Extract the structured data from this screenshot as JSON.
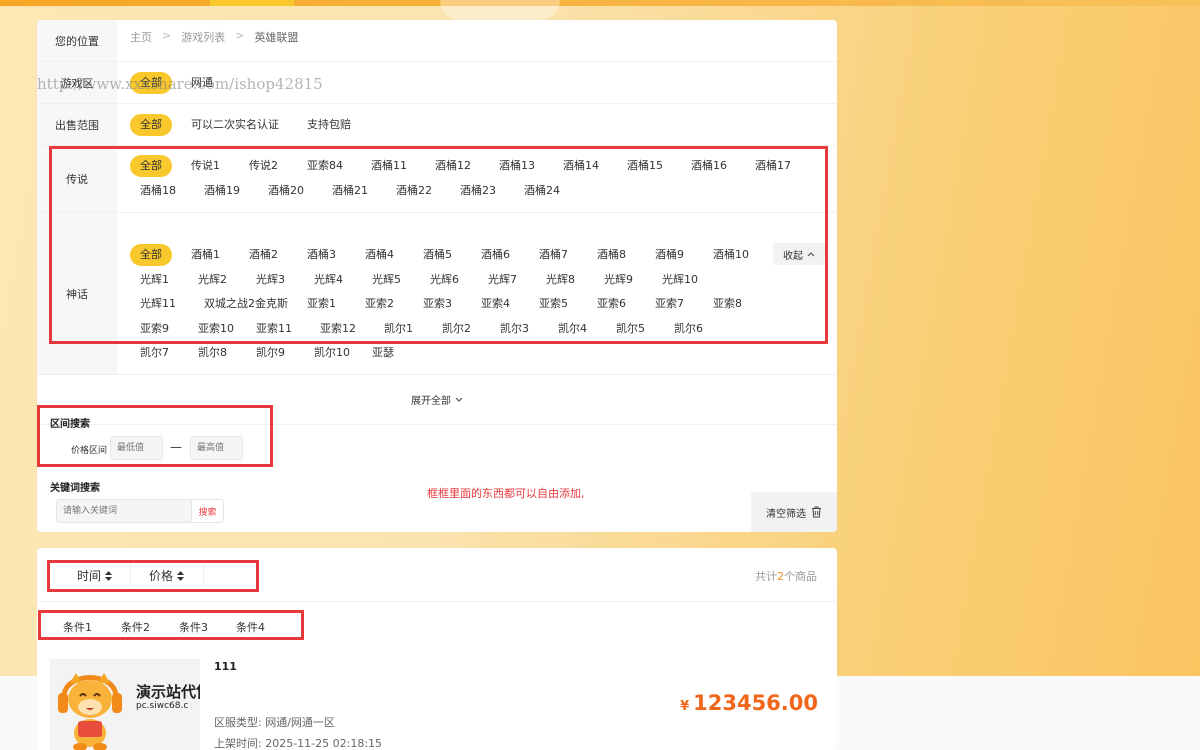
{
  "breadcrumb": {
    "label": "您的位置",
    "items": [
      "主页",
      "游戏列表",
      "英雄联盟"
    ],
    "sep": ">"
  },
  "watermark": "http://www.xxxshare.com/ishop42815",
  "filters": {
    "zone": {
      "label": "游戏区",
      "options": [
        "全部",
        "网通"
      ]
    },
    "scope": {
      "label": "出售范围",
      "options": [
        "全部",
        "可以二次实名认证",
        "支持包赔"
      ]
    },
    "legend": {
      "label": "传说",
      "options": [
        "全部",
        "传说1",
        "传说2",
        "亚索84",
        "酒桶11",
        "酒桶12",
        "酒桶13",
        "酒桶14",
        "酒桶15",
        "酒桶16",
        "酒桶17",
        "酒桶18",
        "酒桶19",
        "酒桶20",
        "酒桶21",
        "酒桶22",
        "酒桶23",
        "酒桶24"
      ]
    },
    "myth": {
      "label": "神话",
      "collapse_label": "收起",
      "options": [
        "全部",
        "酒桶1",
        "酒桶2",
        "酒桶3",
        "酒桶4",
        "酒桶5",
        "酒桶6",
        "酒桶7",
        "酒桶8",
        "酒桶9",
        "酒桶10",
        "光辉1",
        "光辉2",
        "光辉3",
        "光辉4",
        "光辉5",
        "光辉6",
        "光辉7",
        "光辉8",
        "光辉9",
        "光辉10",
        "光辉11",
        "双城之战2金克斯",
        "亚索1",
        "亚索2",
        "亚索3",
        "亚索4",
        "亚索5",
        "亚索6",
        "亚索7",
        "亚索8",
        "亚索9",
        "亚索10",
        "亚索11",
        "亚索12",
        "凯尔1",
        "凯尔2",
        "凯尔3",
        "凯尔4",
        "凯尔5",
        "凯尔6",
        "凯尔7",
        "凯尔8",
        "凯尔9",
        "凯尔10",
        "亚瑟"
      ]
    },
    "expand_all": "展开全部"
  },
  "range_search": {
    "title": "区间搜索",
    "price_label": "价格区间",
    "min_placeholder": "最低值",
    "max_placeholder": "最高值",
    "dash": "—"
  },
  "keyword_search": {
    "title": "关键词搜索",
    "placeholder": "请输入关键词",
    "button": "搜索"
  },
  "note": "框框里面的东西都可以自由添加,",
  "clear_button": "清空筛选",
  "sort": {
    "time": "时间",
    "price": "价格"
  },
  "total": {
    "prefix": "共计",
    "count": "2",
    "suffix": "个商品"
  },
  "conditions": [
    "条件1",
    "条件2",
    "条件3",
    "条件4"
  ],
  "item": {
    "title": "111",
    "thumb_text": "演示站代售",
    "thumb_sub": "pc.siwc68.c",
    "zone_type_label": "区服类型:",
    "zone_type_value": "网通/网通一区",
    "listed_label": "上架时间:",
    "listed_value": "2025-11-25 02:18:15",
    "currency": "¥",
    "price": "123456.00"
  },
  "colors": {
    "accent": "#f8c82c",
    "highlight_box": "#e5393b",
    "price": "#f0671c"
  }
}
